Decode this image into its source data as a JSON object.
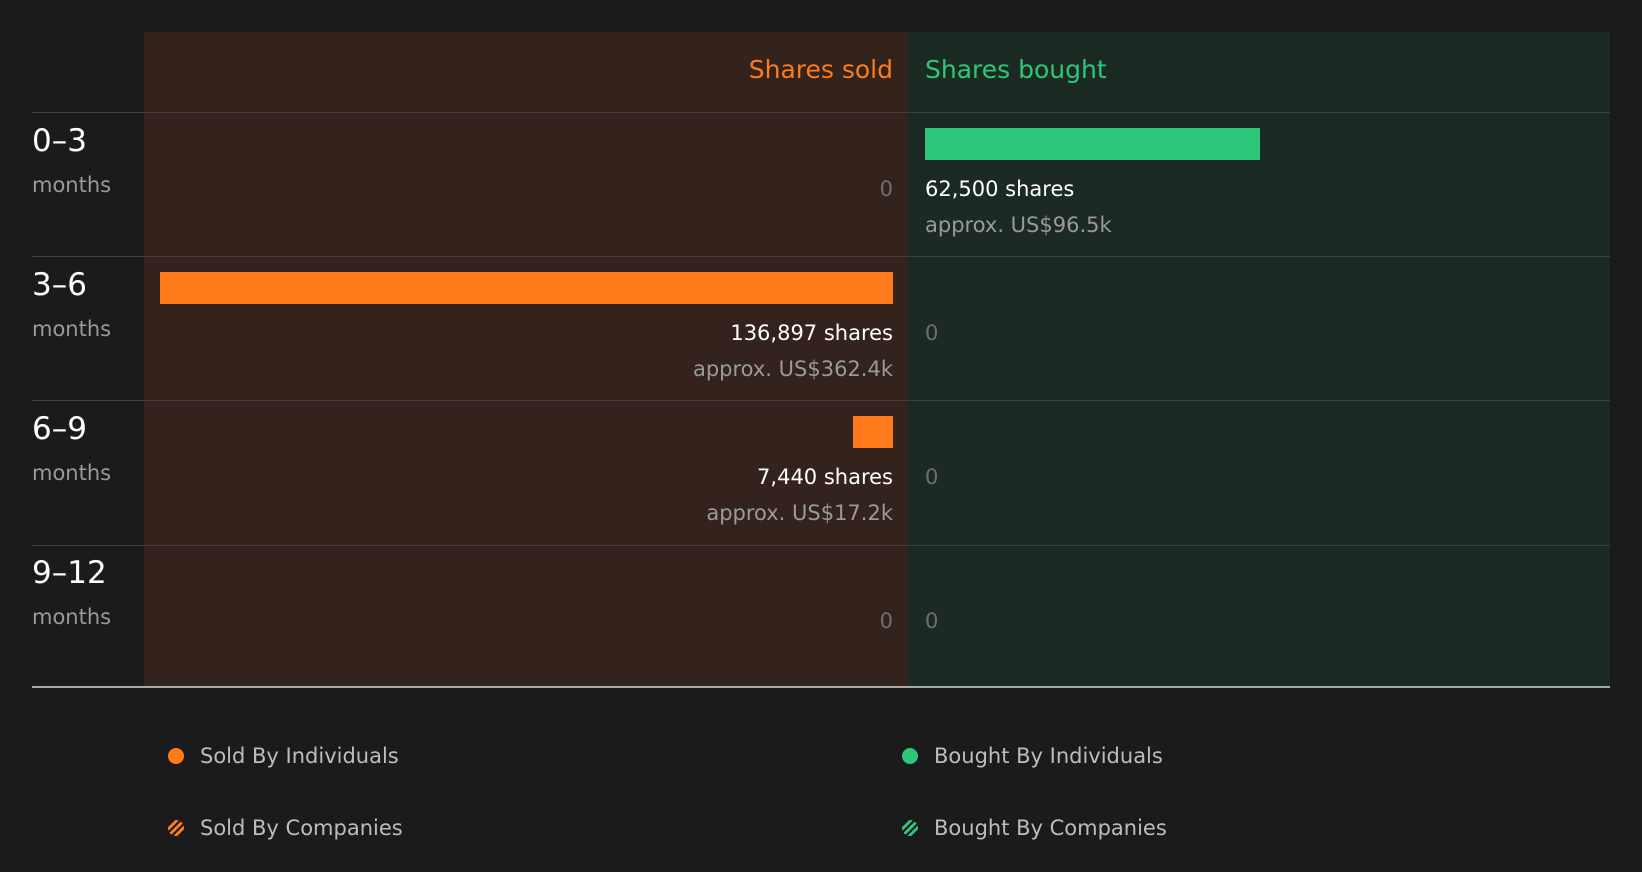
{
  "colors": {
    "sold": "#ff7a1a",
    "bought": "#2ec77a",
    "sold_panel": "#33231c",
    "bought_panel": "#1c2a24",
    "background": "#1b1b1b"
  },
  "headers": {
    "sold": "Shares sold",
    "bought": "Shares bought"
  },
  "rows": [
    {
      "range": "0–3",
      "unit": "months",
      "sold": {
        "shares_label": "",
        "approx_label": "",
        "zero_label": "0"
      },
      "bought": {
        "shares_label": "62,500 shares",
        "approx_label": "approx. US$96.5k",
        "zero_label": ""
      }
    },
    {
      "range": "3–6",
      "unit": "months",
      "sold": {
        "shares_label": "136,897 shares",
        "approx_label": "approx. US$362.4k",
        "zero_label": ""
      },
      "bought": {
        "shares_label": "",
        "approx_label": "",
        "zero_label": "0"
      }
    },
    {
      "range": "6–9",
      "unit": "months",
      "sold": {
        "shares_label": "7,440 shares",
        "approx_label": "approx. US$17.2k",
        "zero_label": ""
      },
      "bought": {
        "shares_label": "",
        "approx_label": "",
        "zero_label": "0"
      }
    },
    {
      "range": "9–12",
      "unit": "months",
      "sold": {
        "shares_label": "",
        "approx_label": "",
        "zero_label": "0"
      },
      "bought": {
        "shares_label": "",
        "approx_label": "",
        "zero_label": "0"
      }
    }
  ],
  "legend": [
    {
      "label": "Sold By Individuals",
      "marker": "solid-dot",
      "color": "#ff7a1a"
    },
    {
      "label": "Bought By Individuals",
      "marker": "solid-dot",
      "color": "#2ec77a"
    },
    {
      "label": "Sold By Companies",
      "marker": "hatched-dot",
      "color": "#ff7a1a"
    },
    {
      "label": "Bought By Companies",
      "marker": "hatched-dot",
      "color": "#2ec77a"
    }
  ],
  "chart_data": {
    "type": "bar",
    "categories": [
      "0–3",
      "3–6",
      "6–9",
      "9–12"
    ],
    "category_unit": "months",
    "orientation": "horizontal-diverging",
    "series": [
      {
        "name": "Shares sold",
        "values": [
          0,
          136897,
          7440,
          0
        ],
        "approx_values_usd_k": [
          0,
          362.4,
          17.2,
          0
        ]
      },
      {
        "name": "Shares bought",
        "values": [
          62500,
          0,
          0,
          0
        ],
        "approx_values_usd_k": [
          96.5,
          0,
          0,
          0
        ]
      }
    ],
    "max_value": 136897,
    "legend_position": "bottom"
  }
}
